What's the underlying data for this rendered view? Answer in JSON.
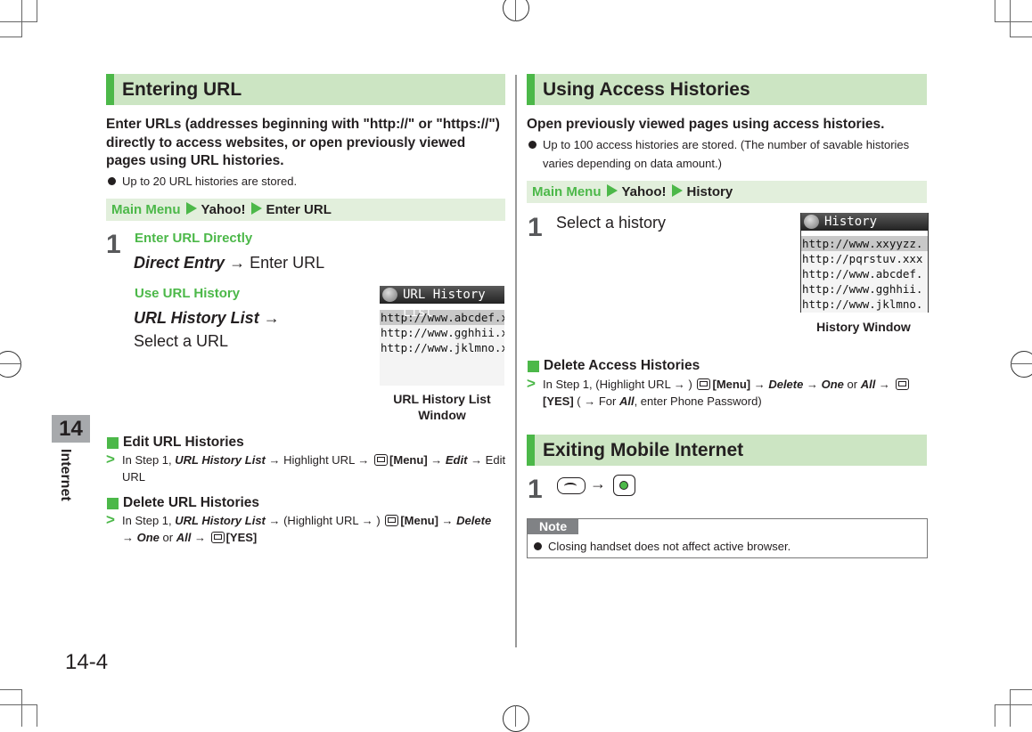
{
  "page": {
    "number": "14-4",
    "chapter_number": "14",
    "chapter_name": "Internet"
  },
  "left": {
    "entering_url": {
      "title": "Entering URL",
      "lead": "Enter URLs (addresses beginning with \"http://\" or \"https://\") directly to access websites, or open previously viewed pages using URL histories.",
      "bullet": "Up to 20 URL histories are stored.",
      "path": {
        "menu": "Main Menu",
        "item1": "Yahoo!",
        "item2": "Enter URL"
      },
      "step_number": "1",
      "direct": {
        "heading": "Enter URL Directly",
        "action": "Direct Entry",
        "arrow": "→",
        "result": "Enter URL"
      },
      "history": {
        "heading": "Use URL History",
        "action": "URL History List",
        "arrow": "→",
        "result": "Select a URL"
      },
      "screen": {
        "title": "URL History List",
        "rows": [
          "http://www.abcdef.xx",
          "http://www.gghhii.xx",
          "http://www.jklmno.xx"
        ],
        "caption_line1": "URL History List",
        "caption_line2": "Window"
      }
    },
    "edit": {
      "heading": "Edit URL Histories",
      "p1": "In Step 1, ",
      "p2": "URL History List",
      "p3": " → Highlight URL → ",
      "p4": "[Menu]",
      "p5": " → ",
      "p6": "Edit",
      "p7": " → Edit URL"
    },
    "delete": {
      "heading": "Delete URL Histories",
      "p1": "In Step 1, ",
      "p2": "URL History List",
      "p3": " → (Highlight URL → ) ",
      "p4": "[Menu]",
      "p5": " → ",
      "p6": "Delete",
      "p7": " → ",
      "p8": "One",
      "p9": " or ",
      "p10": "All",
      "p11": " → ",
      "p12": "[YES]"
    }
  },
  "right": {
    "access": {
      "title": "Using Access Histories",
      "lead": "Open previously viewed pages using access histories.",
      "bullet": "Up to 100 access histories are stored. (The number of savable histories varies depending on data amount.)",
      "path": {
        "menu": "Main Menu",
        "item1": "Yahoo!",
        "item2": "History"
      },
      "step_number": "1",
      "step_text": "Select a history",
      "screen": {
        "title": "History",
        "rows": [
          "http://www.xxyyzz.",
          "http://pqrstuv.xxx",
          "http://www.abcdef.",
          "http://www.gghhii.",
          "http://www.jklmno."
        ],
        "caption": "History Window"
      },
      "delete": {
        "heading": "Delete Access Histories",
        "p1": "In Step 1, (Highlight URL → ) ",
        "p2": "[Menu]",
        "p3": " → ",
        "p4": "Delete",
        "p5": " → ",
        "p6": "One",
        "p7": " or ",
        "p8": "All",
        "p9": " → ",
        "p10": "[YES]",
        "p11": " ( → For ",
        "p12": "All",
        "p13": ", enter Phone Password)"
      }
    },
    "exiting": {
      "title": "Exiting Mobile Internet",
      "step_number": "1",
      "arrow": "→",
      "note_label": "Note",
      "note": "Closing handset does not affect active browser."
    }
  }
}
